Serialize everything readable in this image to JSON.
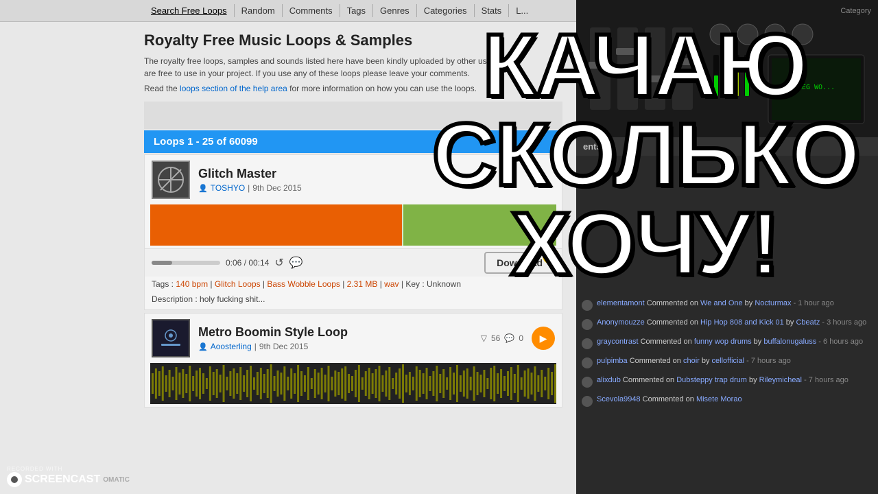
{
  "nav": {
    "items": [
      {
        "label": "Search Free Loops",
        "active": true
      },
      {
        "label": "Random"
      },
      {
        "label": "Comments"
      },
      {
        "label": "Tags"
      },
      {
        "label": "Genres"
      },
      {
        "label": "Categories"
      },
      {
        "label": "Stats"
      },
      {
        "label": "L..."
      }
    ]
  },
  "page": {
    "title": "Royalty Free Music Loops & Samples",
    "description": "The royalty free loops, samples and sounds listed here have been kindly uploaded by other users and are free to use in your project. If you use any of these loops please leave your comments.",
    "help_text": "Read the",
    "help_link_text": "loops section of the help area",
    "help_text2": "for more information on how you can use the loops."
  },
  "loops_header": {
    "text": "Loops 1 - 25 of 60099"
  },
  "loop1": {
    "title": "Glitch Master",
    "user": "TOSHYO",
    "date": "9th Dec 2015",
    "time_current": "0:06",
    "time_total": "00:14",
    "download_label": "Download",
    "tags": "Tags :",
    "bpm": "140 bpm",
    "tag1": "Glitch Loops",
    "tag2": "Bass Wobble Loops",
    "filesize": "2.31 MB",
    "format": "wav",
    "key": "Key : Unknown",
    "description": "Description : holy fucking shit..."
  },
  "loop2": {
    "title": "Metro Boomin Style Loop",
    "user": "Aoosterling",
    "date": "9th Dec 2015",
    "plays": "56",
    "comments": "0"
  },
  "overlay": {
    "line1": "КАЧАЮ",
    "line2": "СКОЛЬКО",
    "line3": "ХОЧУ!"
  },
  "watermark": {
    "top_text": "RECORDED WITH",
    "brand": "SCREENCAST",
    "brand2": "OMATIC"
  },
  "sidebar": {
    "category_label": "Category",
    "comments_header": "ents",
    "comments": [
      {
        "user": "elementamont",
        "action": "Commented on",
        "track": "We and One",
        "by": "by",
        "author": "Nocturmax",
        "time": "- 1 hour ago"
      },
      {
        "user": "Anonymouzze",
        "action": "Commented on",
        "track": "Hip Hop 808 and Kick 01",
        "by": "by",
        "author": "Cbeatz",
        "time": "- 3 hours ago"
      },
      {
        "user": "graycontrast",
        "action": "Commented on",
        "track": "funny wop drums",
        "by": "by",
        "author": "buffalonugaluss",
        "time": "- 6 hours ago"
      },
      {
        "user": "pulpimba",
        "action": "Commented on",
        "track": "choir",
        "by": "by",
        "author": "cellofficial",
        "time": "- 7 hours ago"
      },
      {
        "user": "alixdub",
        "action": "Commented on",
        "track": "Dubsteppy trap drum",
        "by": "by",
        "author": "Rileymicheal",
        "time": "- 7 hours ago"
      },
      {
        "user": "Scevola9948",
        "action": "Commented on",
        "track": "Misete Morao",
        "by": "by",
        "author": "",
        "time": ""
      }
    ]
  }
}
